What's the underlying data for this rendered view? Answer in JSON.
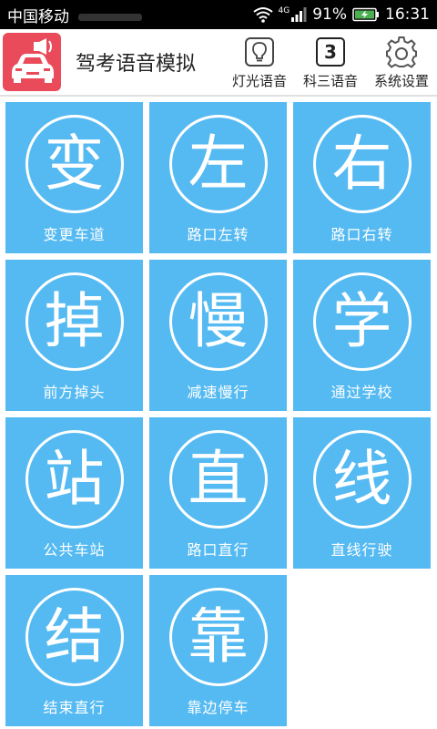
{
  "status_bar": {
    "carrier": "中国移动",
    "network": "4G",
    "battery": "91%",
    "time": "16:31"
  },
  "header": {
    "app_icon": "car-horn-icon",
    "title": "驾考语音模拟",
    "buttons": [
      {
        "label": "灯光语音",
        "icon": "lightbulb-icon"
      },
      {
        "label": "科三语音",
        "icon": "number-badge-icon",
        "badge": "3"
      },
      {
        "label": "系统设置",
        "icon": "gear-icon"
      }
    ]
  },
  "tiles": [
    {
      "glyph": "变",
      "label": "变更车道"
    },
    {
      "glyph": "左",
      "label": "路口左转"
    },
    {
      "glyph": "右",
      "label": "路口右转"
    },
    {
      "glyph": "掉",
      "label": "前方掉头"
    },
    {
      "glyph": "慢",
      "label": "减速慢行"
    },
    {
      "glyph": "学",
      "label": "通过学校"
    },
    {
      "glyph": "站",
      "label": "公共车站"
    },
    {
      "glyph": "直",
      "label": "路口直行"
    },
    {
      "glyph": "线",
      "label": "直线行驶"
    },
    {
      "glyph": "结",
      "label": "结束直行"
    },
    {
      "glyph": "靠",
      "label": "靠边停车"
    }
  ],
  "colors": {
    "tile": "#55baf2",
    "logo": "#ea4b5b",
    "status_bar": "#000000"
  }
}
